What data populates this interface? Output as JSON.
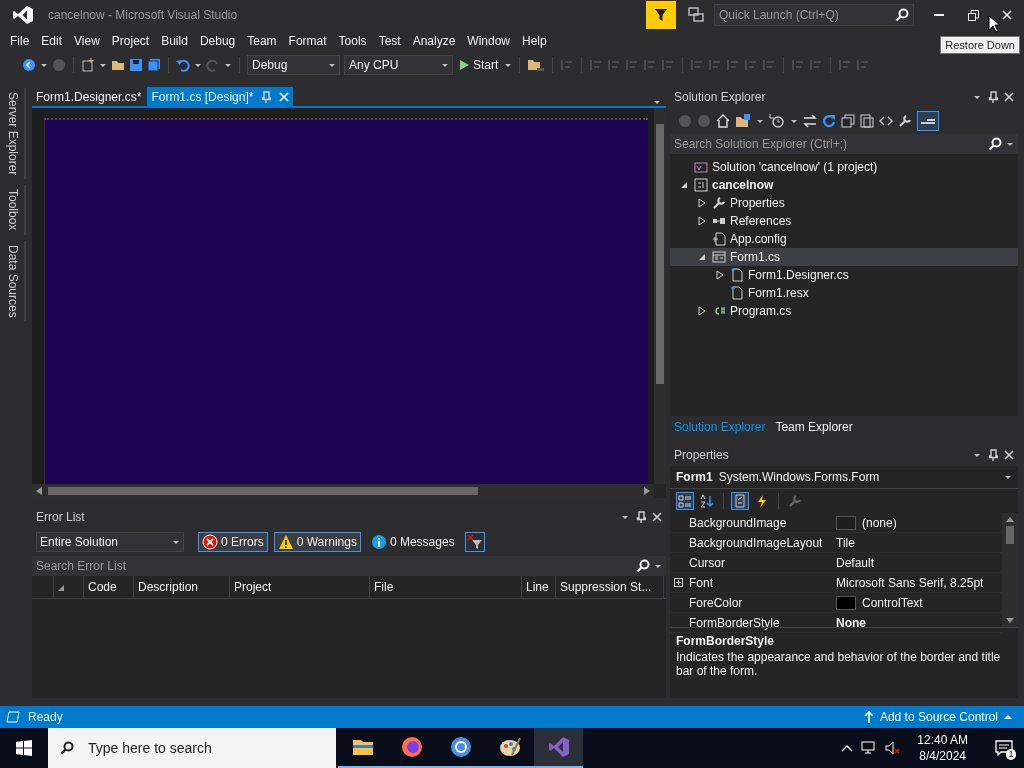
{
  "window": {
    "title": "cancelnow - Microsoft Visual Studio"
  },
  "quick_launch": {
    "placeholder": "Quick Launch (Ctrl+Q)"
  },
  "tooltip": "Restore Down",
  "menu": [
    "File",
    "Edit",
    "View",
    "Project",
    "Build",
    "Debug",
    "Team",
    "Format",
    "Tools",
    "Test",
    "Analyze",
    "Window",
    "Help"
  ],
  "toolbar": {
    "configuration": "Debug",
    "platform": "Any CPU",
    "start": "Start"
  },
  "side_tabs": [
    "Server Explorer",
    "Toolbox",
    "Data Sources"
  ],
  "document_tabs": [
    {
      "label": "Form1.Designer.cs*",
      "selected": false
    },
    {
      "label": "Form1.cs [Design]*",
      "selected": true
    }
  ],
  "error_list": {
    "title": "Error List",
    "scope": "Entire Solution",
    "filters": [
      {
        "kind": "error",
        "label": "0 Errors",
        "on": true
      },
      {
        "kind": "warning",
        "label": "0 Warnings",
        "on": true
      },
      {
        "kind": "info",
        "label": "0 Messages",
        "on": false
      }
    ],
    "search": {
      "placeholder": "Search Error List"
    },
    "columns": [
      "Code",
      "Description",
      "Project",
      "File",
      "Line",
      "Suppression St..."
    ]
  },
  "solution_explorer": {
    "title": "Solution Explorer",
    "search": {
      "placeholder": "Search Solution Explorer (Ctrl+;)"
    },
    "tree": [
      {
        "kind": "solution",
        "label": "Solution 'cancelnow' (1 project)",
        "selected": false,
        "children": [
          {
            "kind": "project",
            "label": "cancelnow",
            "expanded": true,
            "selected": false,
            "children": [
              {
                "kind": "properties",
                "label": "Properties",
                "expanded": false,
                "selected": false
              },
              {
                "kind": "references",
                "label": "References",
                "expanded": false,
                "selected": false
              },
              {
                "kind": "config",
                "label": "App.config",
                "selected": false
              },
              {
                "kind": "form",
                "label": "Form1.cs",
                "expanded": true,
                "selected": true,
                "children": [
                  {
                    "kind": "file",
                    "label": "Form1.Designer.cs",
                    "expanded": false,
                    "selected": false
                  },
                  {
                    "kind": "file",
                    "label": "Form1.resx",
                    "selected": false
                  }
                ]
              },
              {
                "kind": "csharp",
                "label": "Program.cs",
                "expanded": false,
                "selected": false
              }
            ]
          }
        ]
      }
    ],
    "tabs": [
      {
        "label": "Solution Explorer",
        "selected": true
      },
      {
        "label": "Team Explorer",
        "selected": false
      }
    ]
  },
  "properties": {
    "title": "Properties",
    "object": "Form1",
    "type": "System.Windows.Forms.Form",
    "rows": [
      {
        "name": "BackgroundImage",
        "value": "(none)",
        "color": "#1e1e1e",
        "modified": false
      },
      {
        "name": "BackgroundImageLayout",
        "value": "Tile",
        "modified": false
      },
      {
        "name": "Cursor",
        "value": "Default",
        "modified": false
      },
      {
        "name": "Font",
        "value": "Microsoft Sans Serif, 8.25pt",
        "expanded": false,
        "modified": false
      },
      {
        "name": "ForeColor",
        "value": "ControlText",
        "color": "#000000",
        "modified": false
      },
      {
        "name": "FormBorderStyle",
        "value": "None",
        "modified": true
      }
    ],
    "description": {
      "title": "FormBorderStyle",
      "text": "Indicates the appearance and behavior of the border and title bar of the form."
    }
  },
  "status_bar": {
    "text": "Ready",
    "source_control": "Add to Source Control"
  },
  "taskbar": {
    "search": {
      "placeholder": "Type here to search"
    },
    "apps": [
      {
        "kind": "folder",
        "selected": false
      },
      {
        "kind": "firefox",
        "selected": false
      },
      {
        "kind": "chrome",
        "selected": false
      },
      {
        "kind": "paint",
        "selected": false
      },
      {
        "kind": "vs",
        "selected": true
      }
    ],
    "time": "12:40 AM",
    "date": "8/4/2024",
    "notifications": "1"
  }
}
